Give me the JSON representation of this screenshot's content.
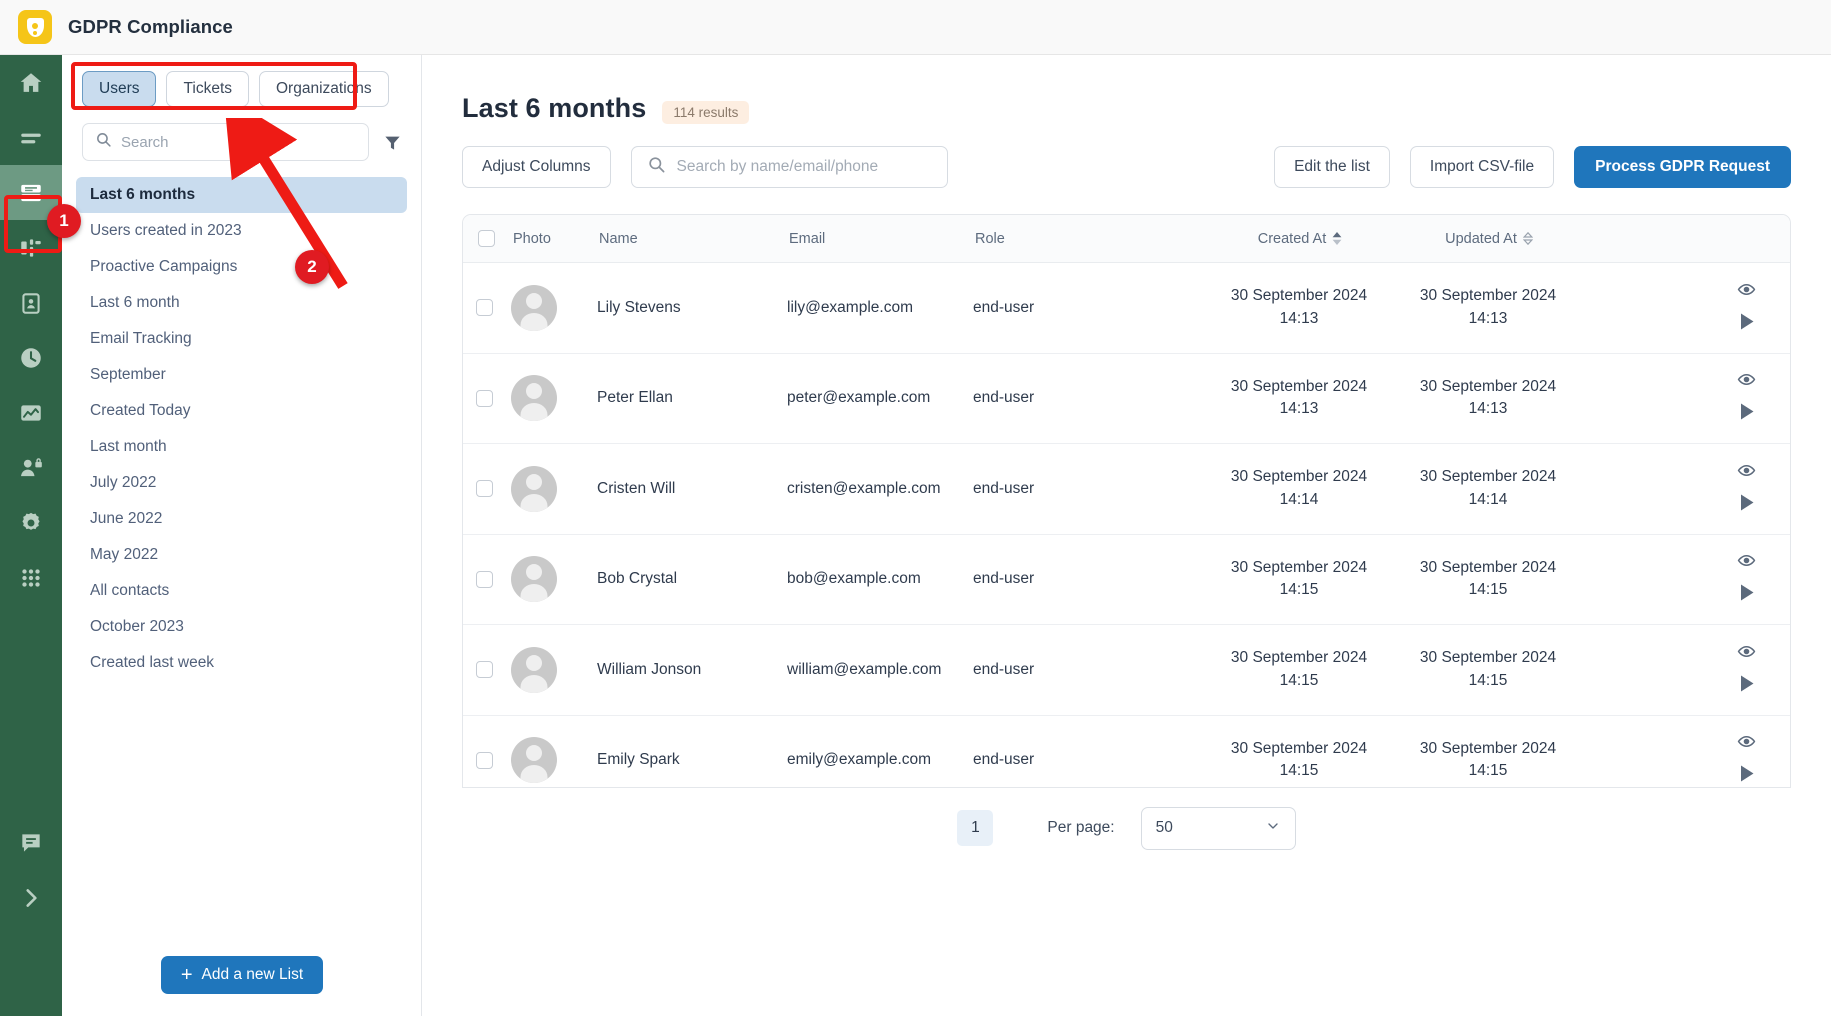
{
  "app": {
    "title": "GDPR Compliance",
    "logo_icon": "shield-user-icon",
    "accent_blue": "#1f76bc",
    "rail_green": "#2f6347",
    "rail_active_green": "#6d9a83",
    "annotation_red": "#e01b22"
  },
  "rail": {
    "items": [
      {
        "name": "home-icon",
        "label": "Home",
        "active": false
      },
      {
        "name": "menu-icon",
        "label": "Menu",
        "active": false
      },
      {
        "name": "database-icon",
        "label": "Lists",
        "active": true
      },
      {
        "name": "flow-icon",
        "label": "Flows",
        "active": false
      },
      {
        "name": "clipboard-user-icon",
        "label": "Contacts",
        "active": false
      },
      {
        "name": "clock-icon",
        "label": "History",
        "active": false
      },
      {
        "name": "chart-icon",
        "label": "Reports",
        "active": false
      },
      {
        "name": "user-lock-icon",
        "label": "Permissions",
        "active": false
      },
      {
        "name": "gear-icon",
        "label": "Settings",
        "active": false
      },
      {
        "name": "grid-apps-icon",
        "label": "Apps",
        "active": false
      }
    ],
    "bottom_items": [
      {
        "name": "chat-icon",
        "label": "Chat"
      },
      {
        "name": "chevron-right-icon",
        "label": "Expand"
      }
    ]
  },
  "lists_panel": {
    "tabs": [
      {
        "label": "Users",
        "selected": true
      },
      {
        "label": "Tickets",
        "selected": false
      },
      {
        "label": "Organizations",
        "selected": false
      }
    ],
    "search": {
      "value": "",
      "placeholder": "Search",
      "icon": "search-icon"
    },
    "filter_icon": "filter-icon",
    "items": [
      {
        "label": "Last 6 months",
        "active": true
      },
      {
        "label": "Users created in 2023",
        "active": false
      },
      {
        "label": "Proactive Campaigns",
        "active": false
      },
      {
        "label": "Last 6 month",
        "active": false
      },
      {
        "label": "Email Tracking",
        "active": false
      },
      {
        "label": "September",
        "active": false
      },
      {
        "label": "Created Today",
        "active": false
      },
      {
        "label": "Last month",
        "active": false
      },
      {
        "label": "July 2022",
        "active": false
      },
      {
        "label": "June 2022",
        "active": false
      },
      {
        "label": "May 2022",
        "active": false
      },
      {
        "label": "All contacts",
        "active": false
      },
      {
        "label": "October 2023",
        "active": false
      },
      {
        "label": "Created last week",
        "active": false
      }
    ],
    "add_button": {
      "label": "Add a new List",
      "icon": "plus-icon"
    }
  },
  "main": {
    "title": "Last 6 months",
    "results_badge": "114 results",
    "toolbar": {
      "adjust_columns": "Adjust Columns",
      "search": {
        "value": "",
        "placeholder": "Search by name/email/phone",
        "icon": "search-icon"
      },
      "edit_list": "Edit the list",
      "import_csv": "Import CSV-file",
      "primary": "Process GDPR Request"
    },
    "table": {
      "columns": [
        {
          "key": "select",
          "label": ""
        },
        {
          "key": "photo",
          "label": "Photo"
        },
        {
          "key": "name",
          "label": "Name"
        },
        {
          "key": "email",
          "label": "Email"
        },
        {
          "key": "role",
          "label": "Role"
        },
        {
          "key": "created_at",
          "label": "Created At",
          "sort": "asc"
        },
        {
          "key": "updated_at",
          "label": "Updated At",
          "sort": "none"
        }
      ],
      "rows": [
        {
          "name": "Lily Stevens",
          "email": "lily@example.com",
          "role": "end-user",
          "created_date": "30 September 2024",
          "created_time": "14:13",
          "updated_date": "30 September 2024",
          "updated_time": "14:13"
        },
        {
          "name": "Peter Ellan",
          "email": "peter@example.com",
          "role": "end-user",
          "created_date": "30 September 2024",
          "created_time": "14:13",
          "updated_date": "30 September 2024",
          "updated_time": "14:13"
        },
        {
          "name": "Cristen Will",
          "email": "cristen@example.com",
          "role": "end-user",
          "created_date": "30 September 2024",
          "created_time": "14:14",
          "updated_date": "30 September 2024",
          "updated_time": "14:14"
        },
        {
          "name": "Bob Crystal",
          "email": "bob@example.com",
          "role": "end-user",
          "created_date": "30 September 2024",
          "created_time": "14:15",
          "updated_date": "30 September 2024",
          "updated_time": "14:15"
        },
        {
          "name": "William Jonson",
          "email": "william@example.com",
          "role": "end-user",
          "created_date": "30 September 2024",
          "created_time": "14:15",
          "updated_date": "30 September 2024",
          "updated_time": "14:15"
        },
        {
          "name": "Emily Spark",
          "email": "emily@example.com",
          "role": "end-user",
          "created_date": "30 September 2024",
          "created_time": "14:15",
          "updated_date": "30 September 2024",
          "updated_time": "14:15"
        }
      ],
      "row_action_icons": [
        "eye-icon",
        "play-triangle-icon"
      ]
    },
    "footer": {
      "page": "1",
      "per_page_label": "Per page:",
      "per_page_value": "50",
      "chevron_icon": "chevron-down-icon"
    }
  },
  "annotations": {
    "badge_1": "1",
    "badge_2": "2"
  }
}
